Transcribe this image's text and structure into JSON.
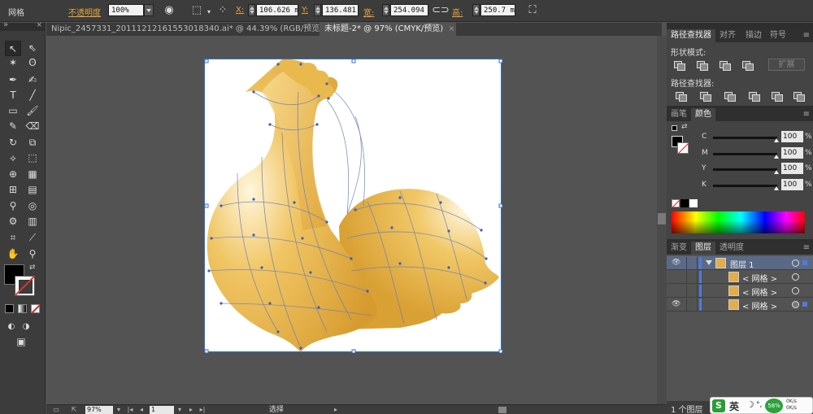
{
  "control_bar": {
    "selection_type": "网格",
    "opacity_label": "不透明度",
    "opacity_value": "100%",
    "x_label": "X:",
    "x_value": "106.626 mm",
    "y_label": "Y:",
    "y_value": "136.481 mm",
    "w_label": "宽:",
    "w_value": "254.094 mm",
    "h_label": "高:",
    "h_value": "250.7 mm"
  },
  "tabs": [
    {
      "label": "Nipic_2457331_20111212161553018340.ai* @ 44.39% (RGB/预览)",
      "active": false
    },
    {
      "label": "未标题-2* @ 97% (CMYK/预览)",
      "active": true
    }
  ],
  "status_bar": {
    "zoom": "97%",
    "page": "1",
    "tool_state": "选择"
  },
  "pathfinder_panel": {
    "tabs": [
      "路径查找器",
      "对齐",
      "描边",
      "符号"
    ],
    "shape_modes_label": "形状模式:",
    "expand_label": "扩展",
    "pathfinders_label": "路径查找器:"
  },
  "color_panel": {
    "tabs": [
      "画笔",
      "颜色"
    ],
    "channels": [
      {
        "label": "C",
        "value": "100"
      },
      {
        "label": "M",
        "value": "100"
      },
      {
        "label": "Y",
        "value": "100"
      },
      {
        "label": "K",
        "value": "100"
      }
    ],
    "percent": "%"
  },
  "layers_panel": {
    "tabs": [
      "渐变",
      "图层",
      "透明度"
    ],
    "layers": [
      {
        "name": "图层 1",
        "visible": true
      },
      {
        "name": "< 网格 >",
        "visible": false
      },
      {
        "name": "< 网格 >",
        "visible": false
      },
      {
        "name": "< 网格 >",
        "visible": true
      }
    ],
    "count": "1 个图层"
  },
  "ime": {
    "logo": "S",
    "language": "英",
    "battery": "58%",
    "net_up": "0K/s",
    "net_down": "0K/s"
  },
  "colors": {
    "app_bg": "#535353",
    "panel_bg": "#3c3c3c",
    "accent": "#e8a33a",
    "selection": "#2b6fd6",
    "artwork_gold": "#e3ad49"
  }
}
